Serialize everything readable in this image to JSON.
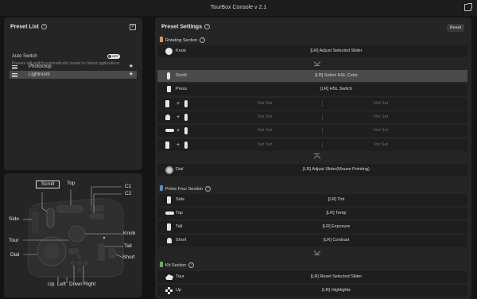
{
  "window": {
    "title": "TourBox Console v 2.1"
  },
  "preset_list": {
    "title": "Preset List",
    "auto_switch_label": "Auto Switch",
    "auto_switch_state": "OFF",
    "auto_switch_desc": "Presets will switch automatically based on linked applications.",
    "presets": [
      {
        "name": "Photoshop",
        "selected": false
      },
      {
        "name": "Lightroom",
        "selected": true
      }
    ]
  },
  "device": {
    "scroll": "Scroll",
    "top": "Top",
    "c1": "C1",
    "c2": "C2",
    "side": "Side",
    "tour": "Tour",
    "knob": "Knob",
    "dial": "Dial",
    "tall": "Tall",
    "short": "Short",
    "up": "Up",
    "left": "Left",
    "down": "Down",
    "right": "Right"
  },
  "settings": {
    "title": "Preset Settings",
    "reset_label": "Reset",
    "colors": {
      "rotating": "#e8953a",
      "prime": "#4a90d9",
      "kit": "#5cb85c",
      "highlight": "#4b4b4b"
    },
    "rotating": {
      "title": "Rotating Section",
      "knob": {
        "label": "Knob",
        "value": "[LR] Adjust Selected Slider"
      },
      "scroll": {
        "label": "Scroll",
        "value": "[LR] Select HSL Color"
      },
      "press": {
        "label": "Press",
        "value": "[LR] HSL Switch"
      },
      "not_set": "Not Set",
      "dial": {
        "label": "Dial",
        "value": "[LR] Adjust Slider(Mouse Pointing)"
      }
    },
    "prime": {
      "title": "Prime Four Section",
      "rows": [
        {
          "label": "Side",
          "value": "[LR] Tint",
          "icon": "side-button-icon"
        },
        {
          "label": "Top",
          "value": "[LR] Temp",
          "icon": "top-button-icon"
        },
        {
          "label": "Tall",
          "value": "[LR] Exposure",
          "icon": "tall-button-icon"
        },
        {
          "label": "Short",
          "value": "[LR] Contrast",
          "icon": "short-button-icon"
        }
      ]
    },
    "kit": {
      "title": "Kit Section",
      "rows": [
        {
          "label": "Tour",
          "value": "[LR] Reset Selected Slider",
          "icon": "tour-button-icon"
        },
        {
          "label": "Up",
          "value": "[LR] Highlights",
          "icon": "dpad-up-icon"
        }
      ]
    }
  }
}
